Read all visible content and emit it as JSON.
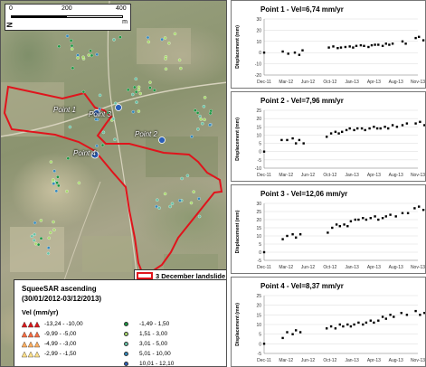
{
  "map": {
    "scale": {
      "tick_0": "0",
      "tick_1": "200",
      "tick_2": "400",
      "unit": "m",
      "north": "N"
    },
    "point_labels": [
      "Point 1",
      "Point 3",
      "Point 2",
      "Point 4"
    ],
    "landslide_label": "3 December landslide",
    "legend": {
      "title": "SqueeSAR ascending",
      "subtitle": "(30/01/2012-03/12/2013)",
      "velocity_label": "Vel (mm/yr)",
      "classes": [
        {
          "label": "-13,24 - -10,00",
          "color": "#d7191c",
          "symbol": "triangle"
        },
        {
          "label": "-9,99 - -5,00",
          "color": "#f46d43",
          "symbol": "triangle"
        },
        {
          "label": "-4,99 - -3,00",
          "color": "#fdae61",
          "symbol": "triangle"
        },
        {
          "label": "-2,99 - -1,50",
          "color": "#fee08b",
          "symbol": "triangle"
        },
        {
          "label": "-1,49 - 1,50",
          "color": "#1a9641",
          "symbol": "dot"
        },
        {
          "label": "1,51 - 3,00",
          "color": "#a6d96a",
          "symbol": "dot"
        },
        {
          "label": "3,01 - 5,00",
          "color": "#66c2a5",
          "symbol": "dot"
        },
        {
          "label": "5,01 - 10,00",
          "color": "#3288bd",
          "symbol": "dot"
        },
        {
          "label": "10,01 - 12,10",
          "color": "#2b5fb8",
          "symbol": "dot"
        }
      ]
    },
    "colors": {
      "landslide": "#e0141c"
    }
  },
  "chart_data": [
    {
      "type": "scatter",
      "title": "Point 1 - Vel=6,74 mm/yr",
      "ylabel": "Displacement (mm)",
      "ylim": [
        -20,
        30
      ],
      "yticks": [
        -20,
        -10,
        0,
        10,
        20,
        30
      ],
      "xticks": [
        "Dec-11",
        "Mar-12",
        "Jun-12",
        "Oct-12",
        "Jan-13",
        "Apr-13",
        "Aug-13",
        "Nov-13"
      ],
      "points": [
        [
          0.0,
          0
        ],
        [
          0.85,
          1
        ],
        [
          1.1,
          -1
        ],
        [
          1.4,
          0
        ],
        [
          1.6,
          -2
        ],
        [
          1.75,
          2
        ],
        [
          2.95,
          4.5
        ],
        [
          3.15,
          5.5
        ],
        [
          3.35,
          4
        ],
        [
          3.5,
          4.5
        ],
        [
          3.7,
          5
        ],
        [
          3.9,
          5.5
        ],
        [
          4.05,
          4.5
        ],
        [
          4.2,
          6
        ],
        [
          4.4,
          6.5
        ],
        [
          4.55,
          6
        ],
        [
          4.75,
          5
        ],
        [
          4.9,
          6.5
        ],
        [
          5.05,
          7
        ],
        [
          5.2,
          7
        ],
        [
          5.4,
          6
        ],
        [
          5.55,
          8
        ],
        [
          5.7,
          7
        ],
        [
          5.85,
          8
        ],
        [
          6.3,
          10
        ],
        [
          6.45,
          8
        ],
        [
          6.9,
          13
        ],
        [
          7.05,
          14
        ],
        [
          7.25,
          11
        ],
        [
          7.4,
          10
        ]
      ]
    },
    {
      "type": "scatter",
      "title": "Point 2 - Vel=7,96 mm/yr",
      "ylabel": "Displacement (mm)",
      "ylim": [
        -10,
        25
      ],
      "yticks": [
        -10,
        -5,
        0,
        5,
        10,
        15,
        20,
        25
      ],
      "xticks": [
        "Dec-11",
        "Mar-12",
        "Jun-12",
        "Oct-12",
        "Jan-13",
        "Apr-13",
        "Aug-13",
        "Nov-13"
      ],
      "points": [
        [
          0.0,
          0
        ],
        [
          0.8,
          7
        ],
        [
          1.05,
          7
        ],
        [
          1.3,
          8
        ],
        [
          1.45,
          5
        ],
        [
          1.6,
          7
        ],
        [
          1.8,
          5
        ],
        [
          2.85,
          9
        ],
        [
          3.05,
          11
        ],
        [
          3.25,
          12
        ],
        [
          3.4,
          11
        ],
        [
          3.55,
          12
        ],
        [
          3.75,
          13
        ],
        [
          3.9,
          14
        ],
        [
          4.1,
          13
        ],
        [
          4.25,
          14
        ],
        [
          4.45,
          14
        ],
        [
          4.6,
          13
        ],
        [
          4.8,
          14
        ],
        [
          5.0,
          15
        ],
        [
          5.15,
          14
        ],
        [
          5.3,
          14
        ],
        [
          5.5,
          15
        ],
        [
          5.65,
          14
        ],
        [
          5.85,
          16
        ],
        [
          6.05,
          15
        ],
        [
          6.3,
          16
        ],
        [
          6.5,
          17
        ],
        [
          6.9,
          17
        ],
        [
          7.1,
          18
        ],
        [
          7.3,
          16
        ],
        [
          7.45,
          17
        ]
      ]
    },
    {
      "type": "scatter",
      "title": "Point 3 - Vel=12,06 mm/yr",
      "ylabel": "Displacement (mm)",
      "ylim": [
        -5,
        30
      ],
      "yticks": [
        -5,
        0,
        5,
        10,
        15,
        20,
        25,
        30
      ],
      "xticks": [
        "Dec-11",
        "Mar-12",
        "Jun-12",
        "Oct-12",
        "Jan-13",
        "Apr-13",
        "Aug-13",
        "Nov-13"
      ],
      "points": [
        [
          0.0,
          0
        ],
        [
          0.85,
          8
        ],
        [
          1.05,
          10
        ],
        [
          1.3,
          11
        ],
        [
          1.45,
          9
        ],
        [
          1.65,
          11
        ],
        [
          2.9,
          12
        ],
        [
          3.1,
          15
        ],
        [
          3.3,
          17
        ],
        [
          3.45,
          16
        ],
        [
          3.65,
          17
        ],
        [
          3.8,
          16
        ],
        [
          3.95,
          19
        ],
        [
          4.15,
          20
        ],
        [
          4.3,
          20
        ],
        [
          4.5,
          21
        ],
        [
          4.65,
          20
        ],
        [
          4.85,
          21
        ],
        [
          5.05,
          22
        ],
        [
          5.2,
          20
        ],
        [
          5.4,
          21
        ],
        [
          5.55,
          22
        ],
        [
          5.75,
          23
        ],
        [
          6.0,
          22
        ],
        [
          6.3,
          24
        ],
        [
          6.55,
          24
        ],
        [
          6.85,
          27
        ],
        [
          7.05,
          28
        ],
        [
          7.25,
          26
        ],
        [
          7.45,
          25
        ]
      ]
    },
    {
      "type": "scatter",
      "title": "Point 4 - Vel=8,37 mm/yr",
      "ylabel": "Displacement (mm)",
      "ylim": [
        -5,
        25
      ],
      "yticks": [
        -5,
        0,
        5,
        10,
        15,
        20,
        25
      ],
      "xticks": [
        "Dec-11",
        "Mar-12",
        "Jun-12",
        "Oct-12",
        "Jan-13",
        "Apr-13",
        "Aug-13",
        "Nov-13"
      ],
      "points": [
        [
          0.0,
          0
        ],
        [
          0.85,
          3
        ],
        [
          1.05,
          6
        ],
        [
          1.3,
          5
        ],
        [
          1.45,
          7
        ],
        [
          1.65,
          6
        ],
        [
          2.85,
          8
        ],
        [
          3.05,
          9
        ],
        [
          3.25,
          8
        ],
        [
          3.45,
          10
        ],
        [
          3.6,
          9
        ],
        [
          3.8,
          10
        ],
        [
          3.95,
          9
        ],
        [
          4.1,
          10
        ],
        [
          4.3,
          11
        ],
        [
          4.5,
          10
        ],
        [
          4.65,
          11
        ],
        [
          4.85,
          12
        ],
        [
          5.0,
          11
        ],
        [
          5.2,
          12
        ],
        [
          5.4,
          14
        ],
        [
          5.55,
          13
        ],
        [
          5.75,
          15
        ],
        [
          5.9,
          14
        ],
        [
          6.25,
          16
        ],
        [
          6.5,
          15
        ],
        [
          6.9,
          17
        ],
        [
          7.1,
          15
        ],
        [
          7.3,
          16
        ],
        [
          7.45,
          17
        ]
      ]
    }
  ]
}
